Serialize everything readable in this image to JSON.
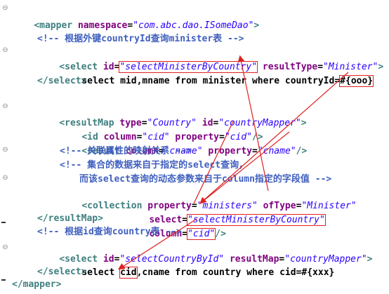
{
  "lines": {
    "l1": {
      "open": "<mapper ",
      "a1": "namespace",
      "eq": "=",
      "v1": "\"com.abc.dao.ISomeDao\"",
      "close": ">"
    },
    "l3": {
      "cmt": "<!-- 根据外键countryId查询minister表 -->"
    },
    "l4": {
      "open": "<select ",
      "a1": "id",
      "eq1": "=",
      "v1": "\"selectMinisterByCountry\"",
      "sp": " ",
      "a2": "resultType",
      "eq2": "=",
      "v2": "\"Minister\"",
      "close": ">"
    },
    "l5": {
      "pre": "select mid,mname from minister where countryId=",
      "hl": "#{ooo}"
    },
    "l6": {
      "close": "</select>"
    },
    "l8": {
      "open": "<resultMap ",
      "a1": "type",
      "eq1": "=",
      "v1": "\"Country\"",
      "sp": " ",
      "a2": "id",
      "eq2": "=",
      "v2": "\"countryMapper\"",
      "close": ">"
    },
    "l9": {
      "open": "<id ",
      "a1": "column",
      "eq1": "=",
      "v1": "\"cid\"",
      "sp": " ",
      "a2": "property",
      "eq2": "=",
      "v2": "\"cid\"",
      "close": "/>"
    },
    "l10": {
      "open": "<result ",
      "a1": "column",
      "eq1": "=",
      "v1": "\"cname\"",
      "sp": " ",
      "a2": "property",
      "eq2": "=",
      "v2": "\"cname\"",
      "close": "/>"
    },
    "l11": {
      "cmt": "<!-- 关联属性的映射关系 -->"
    },
    "l12": {
      "cmt": "<!-- 集合的数据来自于指定的select查询，"
    },
    "l13": {
      "cmt": "而该select查询的动态参数来自于column指定的字段值 -->"
    },
    "l14": {
      "open": "<collection ",
      "a1": "property",
      "eq1": "=",
      "v1": "\"ministers\"",
      "sp": " ",
      "a2": "ofType",
      "eq2": "=",
      "v2": "\"Minister\""
    },
    "l15": {
      "a1": "select",
      "eq1": "=",
      "v1": "\"selectMinisterByCountry\""
    },
    "l16": {
      "a1": "column",
      "eq1": "=",
      "v1": "\"cid\"",
      "close": "/>"
    },
    "l17": {
      "close": "</resultMap>"
    },
    "l18": {
      "cmt": "<!-- 根据id查询country表 -->"
    },
    "l19": {
      "open": "<select ",
      "a1": "id",
      "eq1": "=",
      "v1": "\"selectCountryById\"",
      "sp": " ",
      "a2": "resultMap",
      "eq2": "=",
      "v2": "\"countryMapper\"",
      "close": ">"
    },
    "l20": {
      "pre": "select ",
      "hl": "cid",
      "post": ",cname from country where cid=#{xxx}"
    },
    "l21": {
      "close": "</select>"
    },
    "l22": {
      "close": "</mapper>"
    }
  },
  "colors": {
    "tag": "#3f7f7f",
    "attr": "#7f007f",
    "value": "#2a00ff",
    "comment": "#3f5fbf",
    "highlight": "#e02020"
  }
}
